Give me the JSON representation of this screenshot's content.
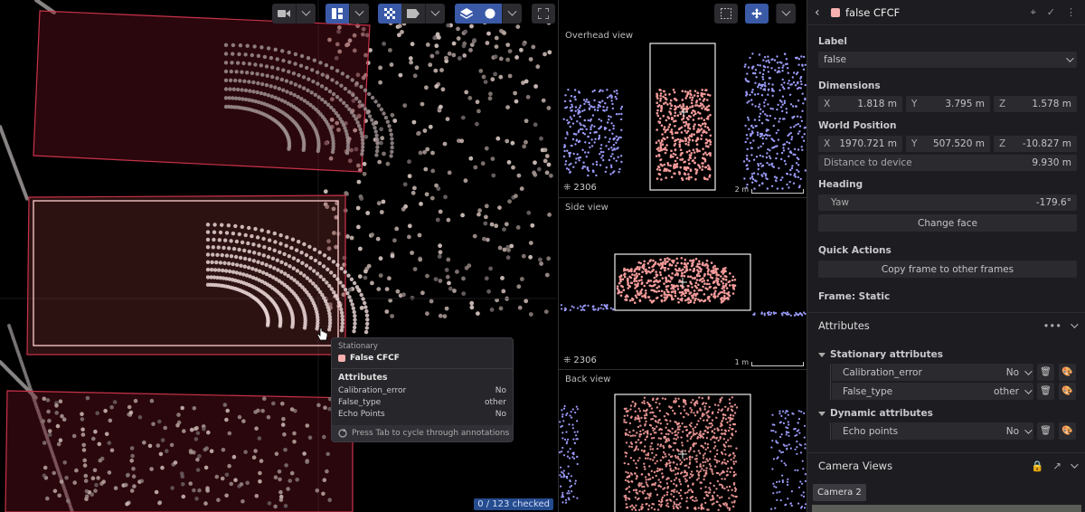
{
  "viewport3d": {
    "checked_status": "0 / 123 checked",
    "tooltip": {
      "kind": "Stationary",
      "name": "False CFCF",
      "attributes_title": "Attributes",
      "rows": [
        {
          "label": "Calibration_error",
          "value": "No"
        },
        {
          "label": "False_type",
          "value": "other"
        },
        {
          "label": "Echo Points",
          "value": "No"
        }
      ],
      "footer": "Press Tab to cycle through annotations"
    }
  },
  "views2d": {
    "overhead": {
      "title": "Overhead view",
      "count": "2306",
      "scale": "2 m"
    },
    "side": {
      "title": "Side view",
      "count": "2306",
      "scale": "1 m"
    },
    "back": {
      "title": "Back view"
    }
  },
  "sidebar": {
    "title": "false CFCF",
    "label_section": "Label",
    "label_value": "false",
    "dimensions_section": "Dimensions",
    "dimensions": [
      {
        "axis": "X",
        "value": "1.818 m"
      },
      {
        "axis": "Y",
        "value": "3.795 m"
      },
      {
        "axis": "Z",
        "value": "1.578 m"
      }
    ],
    "world_position_section": "World Position",
    "world_position": [
      {
        "axis": "X",
        "value": "1970.721 m"
      },
      {
        "axis": "Y",
        "value": "507.520 m"
      },
      {
        "axis": "Z",
        "value": "-10.827 m"
      }
    ],
    "distance_label": "Distance to device",
    "distance_value": "9.930 m",
    "heading_section": "Heading",
    "yaw_label": "Yaw",
    "yaw_value": "-179.6°",
    "change_face": "Change face",
    "quick_actions_section": "Quick Actions",
    "copy_frame": "Copy frame to other frames",
    "frame_status": "Frame: Static",
    "attributes_section": "Attributes",
    "stationary_group": "Stationary attributes",
    "stationary_attrs": [
      {
        "name": "Calibration_error",
        "value": "No"
      },
      {
        "name": "False_type",
        "value": "other"
      }
    ],
    "dynamic_group": "Dynamic attributes",
    "dynamic_attrs": [
      {
        "name": "Echo points",
        "value": "No"
      }
    ],
    "camera_views_section": "Camera Views",
    "camera_chip": "Camera 2"
  },
  "colors": {
    "accent": "#3a5aa8",
    "annotation": "#f6b0b0",
    "box_selected": "#e05a6a",
    "cloud_blue": "#9a9af8",
    "cloud_pink": "#f49a9a"
  }
}
